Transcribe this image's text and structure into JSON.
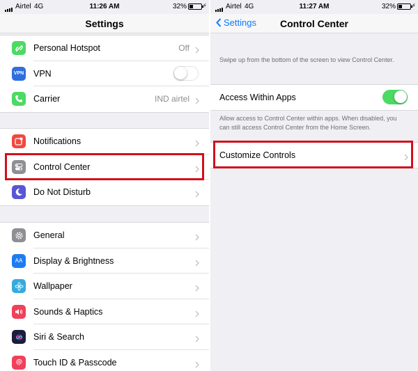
{
  "left_screen": {
    "status_bar": {
      "carrier": "Airtel",
      "network": "4G",
      "time": "11:26 AM",
      "battery": "32%",
      "battery_level": 0.32
    },
    "nav": {
      "title": "Settings"
    },
    "group1": [
      {
        "label": "Personal Hotspot",
        "value": "Off",
        "icon": "hotspot-icon",
        "color": "#4cd964"
      },
      {
        "label": "VPN",
        "icon": "vpn-icon",
        "icon_text": "VPN",
        "color": "#2f6fde",
        "toggle": "off"
      },
      {
        "label": "Carrier",
        "value": "IND airtel",
        "icon": "phone-icon",
        "color": "#4cd964"
      }
    ],
    "group2": [
      {
        "label": "Notifications",
        "icon": "notifications-icon",
        "color": "#f0493e"
      },
      {
        "label": "Control Center",
        "icon": "control-center-icon",
        "color": "#8e8e93"
      },
      {
        "label": "Do Not Disturb",
        "icon": "moon-icon",
        "color": "#5856d6"
      }
    ],
    "group3": [
      {
        "label": "General",
        "icon": "gear-icon",
        "color": "#8e8e93"
      },
      {
        "label": "Display & Brightness",
        "icon": "display-icon",
        "icon_text": "AA",
        "color": "#1e7cf2"
      },
      {
        "label": "Wallpaper",
        "icon": "wallpaper-icon",
        "color": "#36aadc"
      },
      {
        "label": "Sounds & Haptics",
        "icon": "speaker-icon",
        "color": "#f0405a"
      },
      {
        "label": "Siri & Search",
        "icon": "siri-icon",
        "color": "#1c1c3c"
      },
      {
        "label": "Touch ID & Passcode",
        "icon": "fingerprint-icon",
        "color": "#f0405a"
      }
    ]
  },
  "right_screen": {
    "status_bar": {
      "carrier": "Airtel",
      "network": "4G",
      "time": "11:27 AM",
      "battery": "32%",
      "battery_level": 0.32
    },
    "nav": {
      "back_label": "Settings",
      "title": "Control Center"
    },
    "intro_note": "Swipe up from the bottom of the screen to view Control Center.",
    "access_within_apps": {
      "label": "Access Within Apps",
      "toggle": "on"
    },
    "access_note": "Allow access to Control Center within apps. When disabled, you can still access Control Center from the Home Screen.",
    "customize_controls": {
      "label": "Customize Controls"
    }
  },
  "colors": {
    "accent": "#0a7aff",
    "highlight": "#d0101b",
    "switch_on": "#4cd964",
    "background": "#efeff4"
  }
}
